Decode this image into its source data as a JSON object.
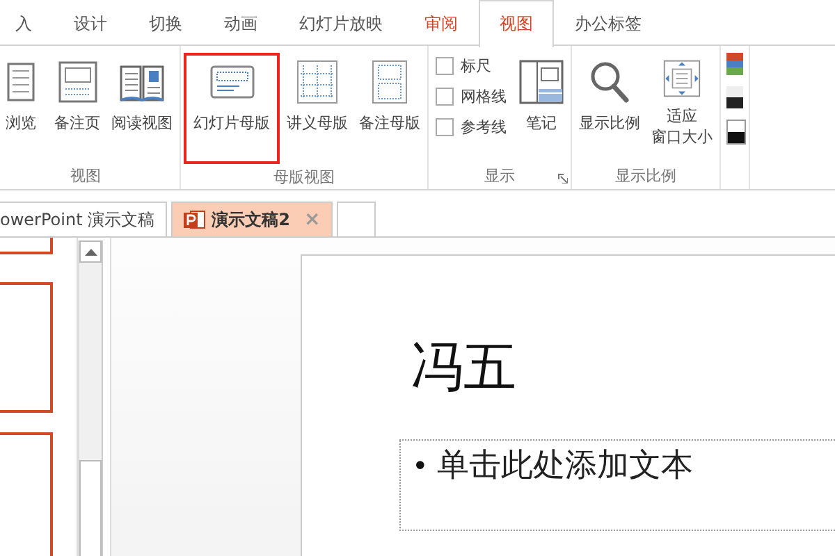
{
  "ribbon_tabs": [
    {
      "label": "入",
      "kind": "plain",
      "selected": false
    },
    {
      "label": "设计",
      "kind": "plain",
      "selected": false
    },
    {
      "label": "切换",
      "kind": "plain",
      "selected": false
    },
    {
      "label": "动画",
      "kind": "plain",
      "selected": false
    },
    {
      "label": "幻灯片放映",
      "kind": "plain",
      "selected": false
    },
    {
      "label": "审阅",
      "kind": "accent",
      "selected": false
    },
    {
      "label": "视图",
      "kind": "accent",
      "selected": true
    },
    {
      "label": "办公标签",
      "kind": "plain",
      "selected": false
    }
  ],
  "ribbon_groups": [
    {
      "label": "视图",
      "items": [
        {
          "kind": "large",
          "label": "浏览",
          "highlighted": false
        },
        {
          "kind": "large",
          "label": "备注页",
          "highlighted": false
        },
        {
          "kind": "large",
          "label": "阅读视图",
          "highlighted": false
        }
      ]
    },
    {
      "label": "母版视图",
      "items": [
        {
          "kind": "large",
          "label": "幻灯片母版",
          "highlighted": true
        },
        {
          "kind": "large",
          "label": "讲义母版",
          "highlighted": false
        },
        {
          "kind": "large",
          "label": "备注母版",
          "highlighted": false
        }
      ]
    },
    {
      "label": "显示",
      "launcher": true,
      "items": [
        {
          "kind": "checks",
          "options": [
            {
              "label": "标尺",
              "checked": false
            },
            {
              "label": "网格线",
              "checked": false
            },
            {
              "label": "参考线",
              "checked": false
            }
          ]
        },
        {
          "kind": "large",
          "label": "笔记",
          "highlighted": false
        }
      ]
    },
    {
      "label": "显示比例",
      "items": [
        {
          "kind": "large",
          "label": "显示比例",
          "highlighted": false
        },
        {
          "kind": "large",
          "label_lines": [
            "适应",
            "窗口大小"
          ],
          "highlighted": false
        }
      ]
    },
    {
      "items": [
        {
          "kind": "colors"
        }
      ]
    }
  ],
  "document_tabs": [
    {
      "label": "owerPoint 演示文稿",
      "selected": false
    },
    {
      "label": "演示文稿2",
      "selected": true,
      "close": "×"
    }
  ],
  "slide": {
    "title": "冯五",
    "body_bullet": "•",
    "body": "单击此处添加文本"
  }
}
